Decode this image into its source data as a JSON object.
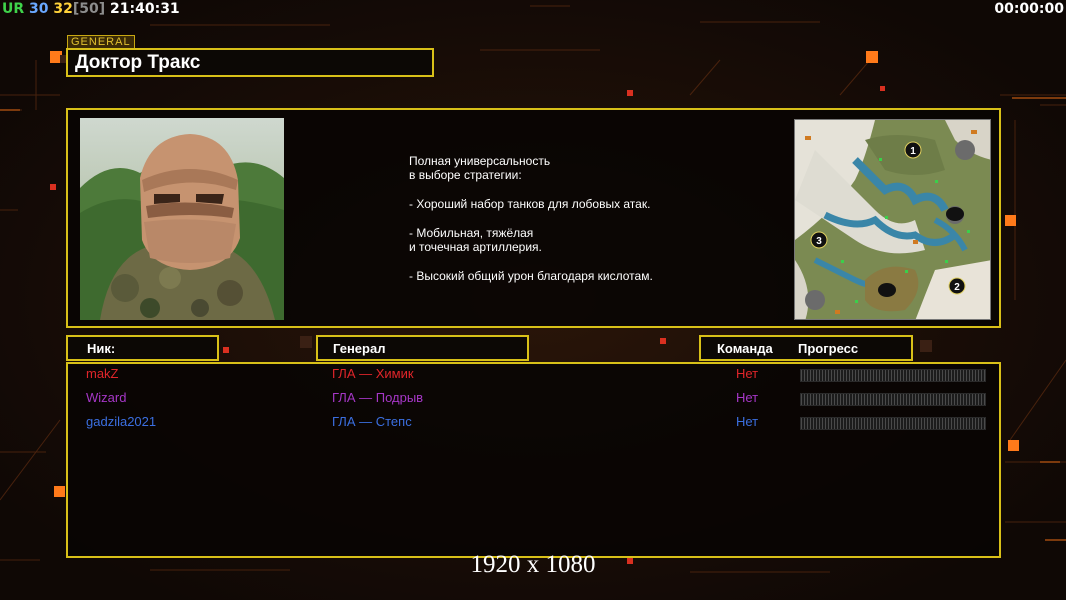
{
  "status_bar": {
    "ur_label": "UR",
    "val_a": "30",
    "val_b": "32",
    "val_c": "[50]",
    "clock": "21:40:31"
  },
  "timer": "00:00:00",
  "general": {
    "tag": "GENERAL",
    "name": "Доктор Тракс",
    "description": "Полная универсальность\nв выборе стратегии:\n\n- Хороший набор танков для лобовых атак.\n\n- Мобильная, тяжёлая\nи точечная артиллерия.\n\n- Высокий общий урон благодаря кислотам."
  },
  "columns": {
    "nick": "Ник:",
    "general": "Генерал",
    "team": "Команда",
    "progress": "Прогресс"
  },
  "players": [
    {
      "nick": "makZ",
      "general": "ГЛА — Химик",
      "team": "Нет",
      "color": "#e0252a"
    },
    {
      "nick": "Wizard",
      "general": "ГЛА — Подрыв",
      "team": "Нет",
      "color": "#a637c7"
    },
    {
      "nick": "gadzila2021",
      "general": "ГЛА — Степс",
      "team": "Нет",
      "color": "#3b6fe0"
    }
  ],
  "map_markers": [
    "1",
    "2",
    "3"
  ],
  "resolution": "1920 x 1080",
  "colors": {
    "frame": "#d8c018",
    "accent": "#ff7a1a",
    "background": "#140c07"
  }
}
